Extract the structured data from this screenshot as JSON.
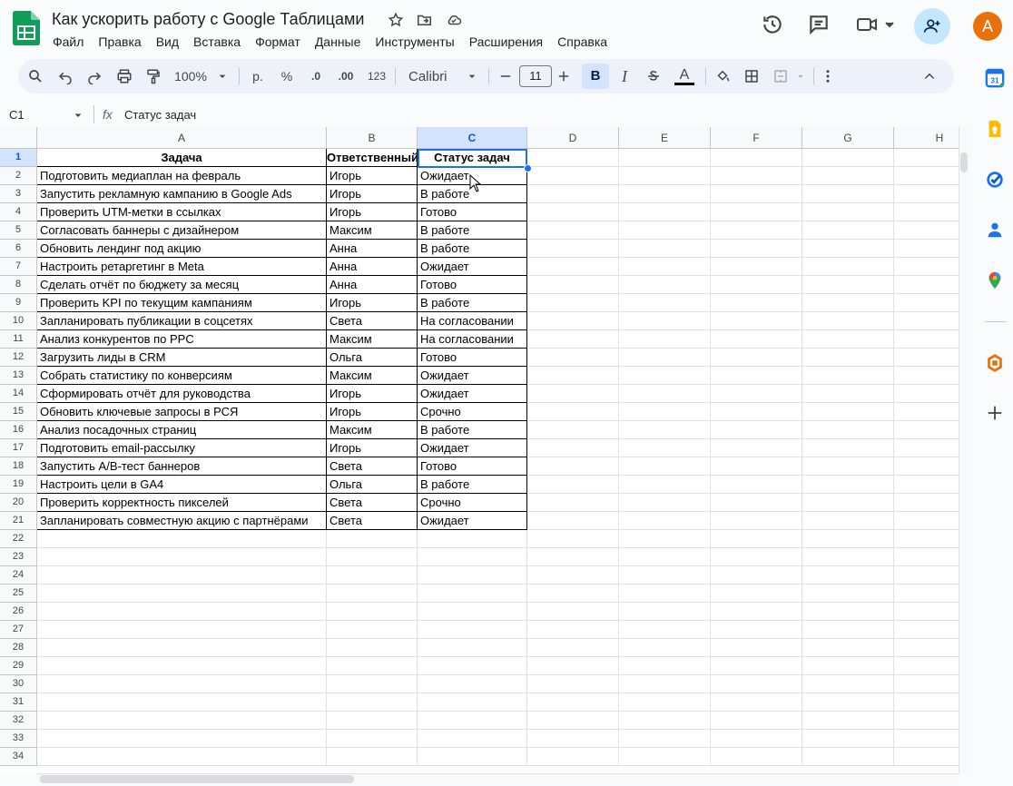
{
  "header": {
    "doc_title": "Как ускорить работу с Google Таблицами",
    "menu": [
      "Файл",
      "Правка",
      "Вид",
      "Вставка",
      "Формат",
      "Данные",
      "Инструменты",
      "Расширения",
      "Справка"
    ],
    "avatar_letter": "A"
  },
  "toolbar": {
    "zoom": "100%",
    "currency": "р.",
    "percent": "%",
    "dec_decrease": ".0",
    "dec_increase": ".00",
    "number_format": "123",
    "font": "Calibri",
    "font_size": "11",
    "bold": "B",
    "italic": "I",
    "text_color": "A"
  },
  "formula_bar": {
    "cell_ref": "C1",
    "fx": "fx",
    "value": "Статус задач"
  },
  "columns": [
    "A",
    "B",
    "C",
    "D",
    "E",
    "F",
    "G",
    "H"
  ],
  "rows": [
    "1",
    "2",
    "3",
    "4",
    "5",
    "6",
    "7",
    "8",
    "9",
    "10",
    "11",
    "12",
    "13",
    "14",
    "15",
    "16",
    "17",
    "18",
    "19",
    "20",
    "21",
    "22",
    "23",
    "24",
    "25",
    "26",
    "27",
    "28",
    "29",
    "30",
    "31",
    "32",
    "33",
    "34"
  ],
  "table": {
    "headers": [
      "Задача",
      "Ответственный",
      "Статус задач"
    ],
    "data": [
      [
        "Подготовить медиаплан на февраль",
        "Игорь",
        "Ожидает"
      ],
      [
        "Запустить рекламную кампанию в Google Ads",
        "Игорь",
        "В работе"
      ],
      [
        "Проверить UTM-метки в ссылках",
        "Игорь",
        "Готово"
      ],
      [
        "Согласовать баннеры с дизайнером",
        "Максим",
        "В работе"
      ],
      [
        "Обновить лендинг под акцию",
        "Анна",
        "В работе"
      ],
      [
        "Настроить ретаргетинг в Meta",
        "Анна",
        "Ожидает"
      ],
      [
        "Сделать отчёт по бюджету за месяц",
        "Анна",
        "Готово"
      ],
      [
        "Проверить KPI по текущим кампаниям",
        "Игорь",
        "В работе"
      ],
      [
        "Запланировать публикации в соцсетях",
        "Света",
        "На согласовании"
      ],
      [
        "Анализ конкурентов по PPC",
        "Максим",
        "На согласовании"
      ],
      [
        "Загрузить лиды в CRM",
        "Ольга",
        "Готово"
      ],
      [
        "Собрать статистику по конверсиям",
        "Максим",
        "Ожидает"
      ],
      [
        "Сформировать отчёт для руководства",
        "Игорь",
        "Ожидает"
      ],
      [
        "Обновить ключевые запросы в РСЯ",
        "Игорь",
        "Срочно"
      ],
      [
        "Анализ посадочных страниц",
        "Максим",
        "В работе"
      ],
      [
        "Подготовить email-рассылку",
        "Игорь",
        "Ожидает"
      ],
      [
        "Запустить A/B-тест баннеров",
        "Света",
        "Готово"
      ],
      [
        "Настроить цели в GA4",
        "Ольга",
        "В работе"
      ],
      [
        "Проверить корректность пикселей",
        "Света",
        "Срочно"
      ],
      [
        "Запланировать совместную акцию с партнёрами",
        "Света",
        "Ожидает"
      ]
    ]
  },
  "colors": {
    "accent": "#1a73e8",
    "selection_header": "#d3e3fd",
    "share_bg": "#c2e7ff",
    "avatar_bg": "#e8710a",
    "sheets_green": "#0f9d58"
  },
  "icons": [
    "star-icon",
    "move-to-folder-icon",
    "cloud-saved-icon",
    "history-icon",
    "comment-icon",
    "meet-icon",
    "add-person-icon",
    "calendar-icon",
    "keep-icon",
    "tasks-icon",
    "contacts-icon",
    "maps-icon",
    "office-addon-icon",
    "plus-icon"
  ]
}
